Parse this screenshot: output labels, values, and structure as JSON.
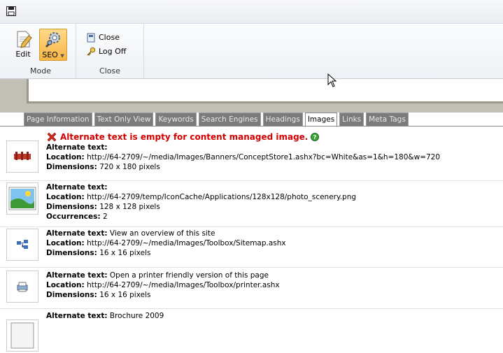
{
  "ribbon": {
    "mode_group": {
      "label": "Mode",
      "edit": "Edit",
      "seo": "SEO"
    },
    "close_group": {
      "label": "Close",
      "close": "Close",
      "logoff": "Log Off"
    }
  },
  "tabs": [
    "Page Information",
    "Text Only View",
    "Keywords",
    "Search Engines",
    "Headings",
    "Images",
    "Links",
    "Meta Tags"
  ],
  "active_tab": "Images",
  "entries": {
    "e0": {
      "warning": "Alternate text is empty for content managed image.",
      "alt_label": "Alternate text:",
      "loc_label": "Location:",
      "loc": "http://64-2709/~/media/Images/Banners/ConceptStore1.ashx?bc=White&as=1&h=180&w=720",
      "dim_label": "Dimensions:",
      "dim": "720 x 180 pixels"
    },
    "e1": {
      "alt_label": "Alternate text:",
      "loc_label": "Location:",
      "loc": "http://64-2709/temp/IconCache/Applications/128x128/photo_scenery.png",
      "dim_label": "Dimensions:",
      "dim": "128 x 128 pixels",
      "occ_label": "Occurrences:",
      "occ": "2"
    },
    "e2": {
      "alt_label": "Alternate text:",
      "alt": "View an overview of this site",
      "loc_label": "Location:",
      "loc": "http://64-2709/~/media/Images/Toolbox/Sitemap.ashx",
      "dim_label": "Dimensions:",
      "dim": "16 x 16 pixels"
    },
    "e3": {
      "alt_label": "Alternate text:",
      "alt": "Open a printer friendly version of this page",
      "loc_label": "Location:",
      "loc": "http://64-2709/~/media/Images/Toolbox/printer.ashx",
      "dim_label": "Dimensions:",
      "dim": "16 x 16 pixels"
    },
    "e4": {
      "alt_label": "Alternate text:",
      "alt": "Brochure 2009"
    }
  },
  "icons": {
    "save": "save-icon",
    "edit": "edit-page-icon",
    "seo": "seo-gear-icon",
    "close": "close-document-icon",
    "logoff": "key-icon",
    "error": "error-x-icon",
    "help": "help-icon"
  },
  "colors": {
    "warning": "#d40000",
    "seo_active": "#f7b645",
    "band": "#c2c0b4",
    "tab": "#7b7b7b"
  }
}
